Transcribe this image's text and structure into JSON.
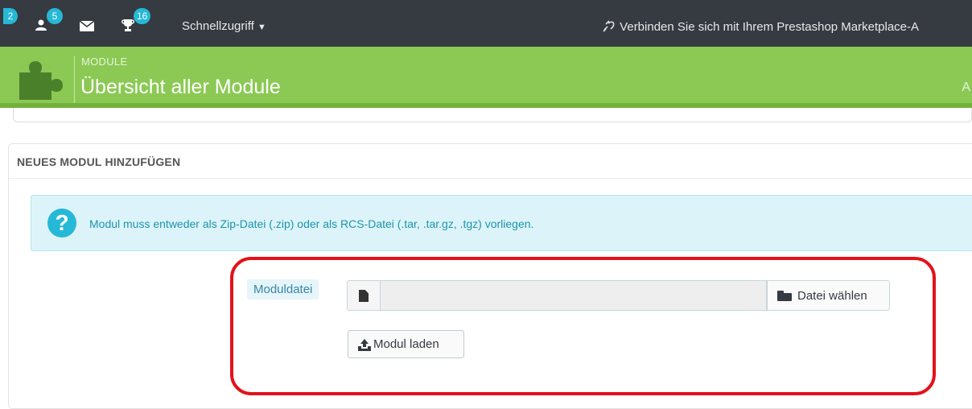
{
  "topbar": {
    "badges": [
      "2",
      "5",
      "16"
    ],
    "quick_access": "Schnellzugriff",
    "marketplace": "Verbinden Sie sich mit Ihrem Prestashop Marketplace-A"
  },
  "header": {
    "breadcrumb": "MODULE",
    "title": "Übersicht aller Module",
    "right_text": "A"
  },
  "panel": {
    "heading": "NEUES MODUL HINZUFÜGEN",
    "alert_icon": "?",
    "alert_text": "Modul muss entweder als Zip-Datei (.zip) oder als RCS-Datei (.tar, .tar.gz, .tgz) vorliegen.",
    "file_label": "Moduldatei",
    "file_value": "",
    "choose_button": "Datei wählen",
    "load_button": "Modul laden"
  },
  "colors": {
    "topbar": "#363a41",
    "header": "#8bc954",
    "accent": "#25b9d7",
    "highlight": "#e3121b"
  },
  "icons": [
    "notification-icon",
    "customer-icon",
    "envelope-icon",
    "trophy-icon",
    "caret-down-icon",
    "plug-icon",
    "puzzle-icon",
    "question-icon",
    "file-icon",
    "folder-open-icon",
    "upload-icon"
  ]
}
